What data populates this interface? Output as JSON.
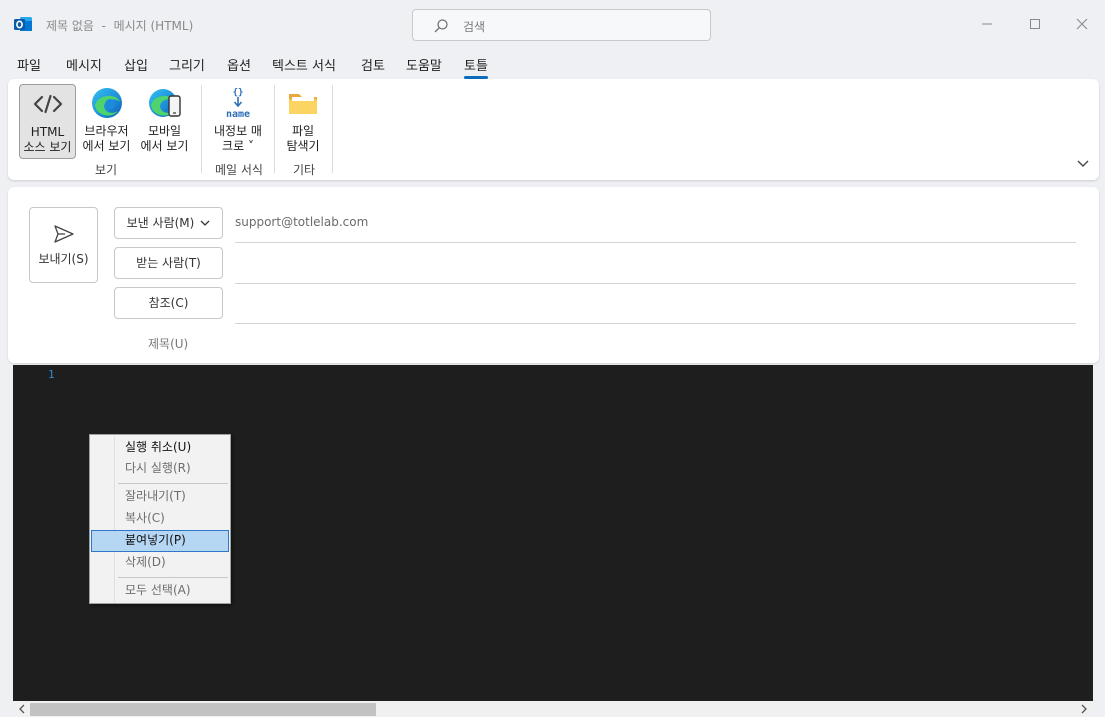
{
  "window": {
    "title": "제목 없음  -  메시지 (HTML)",
    "search_placeholder": "검색"
  },
  "menu": {
    "tabs": [
      "파일",
      "메시지",
      "삽입",
      "그리기",
      "옵션",
      "텍스트 서식",
      "검토",
      "도움말",
      "토틀"
    ],
    "active_tab": "토틀"
  },
  "ribbon": {
    "buttons": [
      {
        "label": "HTML\n소스 보기",
        "icon": "code-icon"
      },
      {
        "label": "브라우저\n에서 보기",
        "icon": "edge-icon"
      },
      {
        "label": "모바일\n에서 보기",
        "icon": "edge-mobile-icon"
      },
      {
        "label": "내정보 매\n크로 ˅",
        "icon": "name-macro-icon",
        "icon_text": "name"
      },
      {
        "label": "파일\n탐색기",
        "icon": "folder-icon"
      }
    ],
    "groups": [
      "보기",
      "메일 서식",
      "기타"
    ]
  },
  "compose": {
    "send_label": "보내기(S)",
    "from_label": "보낸 사람(M)",
    "from_value": "support@totlelab.com",
    "to_label": "받는 사람(T)",
    "cc_label": "참조(C)",
    "subject_label": "제목(U)"
  },
  "editor": {
    "line_number": "1"
  },
  "context_menu": {
    "items": [
      {
        "label": "실행 취소(U)",
        "enabled": true
      },
      {
        "label": "다시 실행(R)",
        "enabled": false
      },
      {
        "label": "잘라내기(T)",
        "enabled": false
      },
      {
        "label": "복사(C)",
        "enabled": false
      },
      {
        "label": "붙여넣기(P)",
        "enabled": true,
        "highlighted": true
      },
      {
        "label": "삭제(D)",
        "enabled": false
      },
      {
        "label": "모두 선택(A)",
        "enabled": false
      }
    ]
  },
  "colors": {
    "accent": "#0f6cbd",
    "editor_bg": "#1e1e1e",
    "menu_highlight": "#b6d7f3"
  }
}
